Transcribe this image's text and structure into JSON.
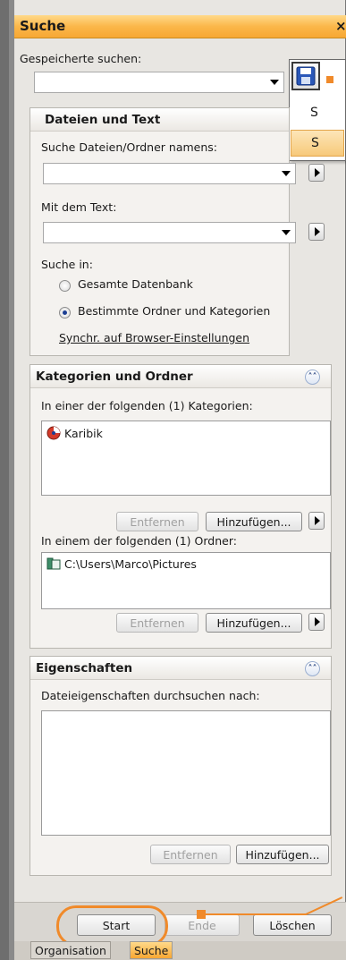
{
  "panel": {
    "title": "Suche",
    "close_glyph": "×"
  },
  "saved": {
    "label": "Gespeicherte suchen:",
    "value": "",
    "save_icon": "save-disk-icon",
    "popup_items": [
      "S",
      "S"
    ]
  },
  "files_section": {
    "title": "Dateien und Text",
    "name_label": "Suche Dateien/Ordner namens:",
    "name_value": "",
    "text_label": "Mit dem Text:",
    "text_value": "",
    "search_in_label": "Suche in:",
    "option_all": "Gesamte Datenbank",
    "option_specific": "Bestimmte Ordner und Kategorien",
    "selected_option": "Bestimmte Ordner und Kategorien",
    "sync_link": "Synchr. auf Browser-Einstellungen"
  },
  "categories_section": {
    "title": "Kategorien und Ordner",
    "categories_label": "In einer der folgenden (1) Kategorien:",
    "categories": [
      {
        "name": "Karibik",
        "icon": "category-icon"
      }
    ],
    "folders_label": "In einem der folgenden (1) Ordner:",
    "folders": [
      {
        "path": "C:\\Users\\Marco\\Pictures",
        "icon": "folder-icon"
      }
    ],
    "remove_label": "Entfernen",
    "add_label": "Hinzufügen..."
  },
  "properties_section": {
    "title": "Eigenschaften",
    "label": "Dateieigenschaften durchsuchen nach:",
    "remove_label": "Entfernen",
    "add_label": "Hinzufügen..."
  },
  "actions": {
    "start": "Start",
    "end": "Ende",
    "clear": "Löschen"
  },
  "tabs": [
    {
      "label": "Organisation",
      "active": false
    },
    {
      "label": "Suche",
      "active": true
    }
  ],
  "colors": {
    "accent": "#f7a733",
    "highlight": "#f08a2a"
  }
}
